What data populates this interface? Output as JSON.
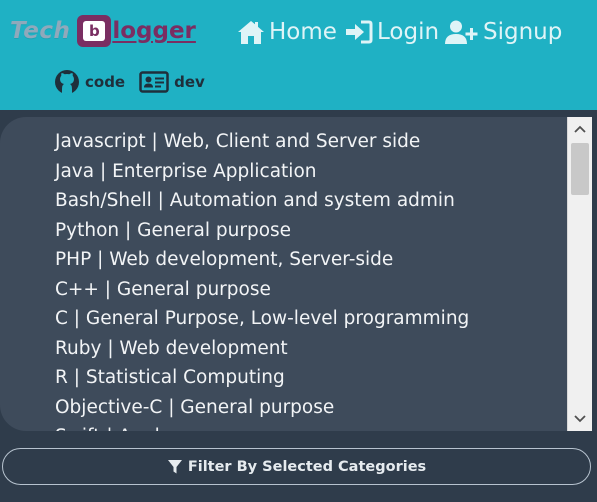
{
  "brand": {
    "part1": "Tech",
    "badge_letter": "b",
    "part2": "logger"
  },
  "nav": {
    "home": "Home",
    "login": "Login",
    "signup": "Signup"
  },
  "sublinks": {
    "code": "code",
    "dev": "dev"
  },
  "languages": [
    "Javascript | Web, Client and Server side",
    "Java | Enterprise Application",
    "Bash/Shell | Automation and system admin",
    "Python | General purpose",
    "PHP | Web development, Server-side",
    "C++ | General purpose",
    "C | General Purpose, Low-level programming",
    "Ruby | Web development",
    "R | Statistical Computing",
    "Objective-C | General purpose",
    "Swift | Apple"
  ],
  "filter": {
    "label": "Filter By Selected Categories"
  },
  "colors": {
    "header_bg": "#1fb1c4",
    "page_bg": "#2f3c4b",
    "list_bg": "#3e4b5b",
    "brand_accent": "#7a2e62"
  }
}
